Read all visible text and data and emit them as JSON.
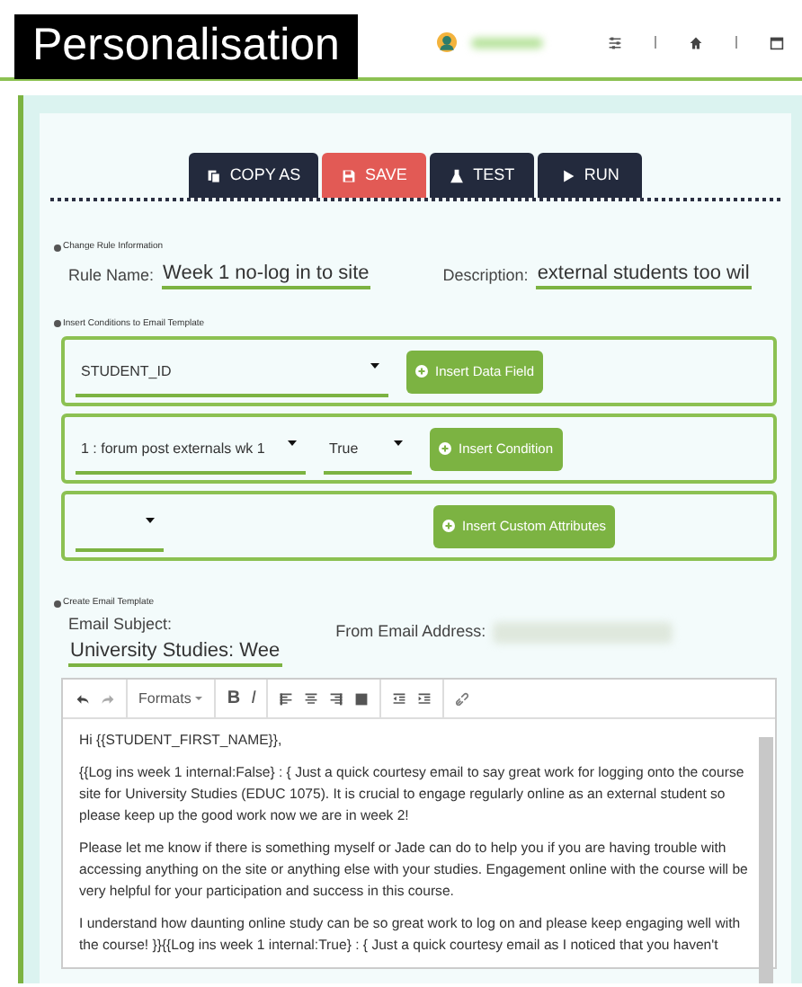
{
  "header": {
    "title": "Personalisation",
    "nav_icons": [
      {
        "kind": "sliders"
      },
      {
        "kind": "home"
      },
      {
        "kind": "calendar"
      }
    ]
  },
  "toolbar": [
    {
      "kind": "copy",
      "label": "COPY AS"
    },
    {
      "kind": "save",
      "label": "SAVE"
    },
    {
      "kind": "test",
      "label": "TEST"
    },
    {
      "kind": "run",
      "label": "RUN"
    }
  ],
  "rule_info": {
    "section_label": "Change Rule Information",
    "name_label": "Rule Name:",
    "name_value": "Week 1 no-log in to site",
    "description_label": "Description:",
    "description_value": "external students too wil"
  },
  "conditions": {
    "section_label": "Insert Conditions to Email Template",
    "rows": [
      {
        "fields": [
          {
            "kind": "wide",
            "value": "STUDENT_ID"
          }
        ],
        "button": "Insert Data Field"
      },
      {
        "fields": [
          {
            "kind": "medium",
            "value": "1 : forum post externals wk 1"
          },
          {
            "kind": "small",
            "value": "True"
          }
        ],
        "button": "Insert Condition"
      },
      {
        "fields": [
          {
            "kind": "empty"
          }
        ],
        "button": "Insert Custom Attributes"
      }
    ]
  },
  "email_template": {
    "section_label": "Create Email Template",
    "subject_label": "Email Subject:",
    "subject_value": "University Studies: Wee",
    "from_label": "From Email Address:"
  },
  "editor": {
    "tools": [
      {
        "kind": "undo"
      },
      {
        "kind": "redo"
      },
      {
        "kind": "formats",
        "label": "Formats"
      },
      {
        "kind": "bold",
        "label": "B"
      },
      {
        "kind": "italic",
        "label": "I"
      },
      {
        "kind": "align-left"
      },
      {
        "kind": "align-center"
      },
      {
        "kind": "align-right"
      },
      {
        "kind": "justify"
      },
      {
        "kind": "outdent"
      },
      {
        "kind": "indent"
      },
      {
        "kind": "link"
      }
    ],
    "paragraphs": [
      "Hi {{STUDENT_FIRST_NAME}},",
      "{{Log ins week 1 internal:False} : { Just a quick courtesy email to say great work for logging onto the course site for University Studies (EDUC 1075). It is crucial to engage regularly online as an external student so please keep up the good work now we are in week 2!",
      "Please let me know if there is something myself or Jade can do to help you if you are having trouble with accessing anything on the site or anything else with your studies. Engagement online with the course will be very helpful for your participation and success in this course.",
      "I understand how daunting online study can be so great work to log on and please keep engaging well with the course! }}{{Log ins week 1 internal:True} : { Just a quick courtesy email as I noticed that you haven't"
    ]
  }
}
